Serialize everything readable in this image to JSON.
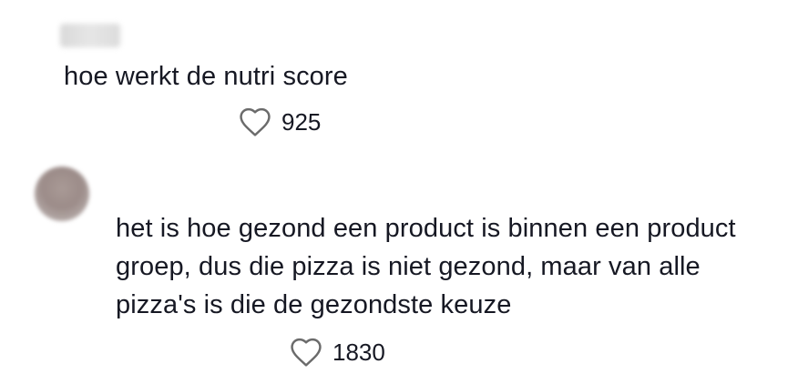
{
  "comments": [
    {
      "text": "hoe werkt de nutri score",
      "likes": "925",
      "like_icon": "heart-outline-icon"
    },
    {
      "text": "het is hoe gezond een product is binnen een product groep, dus die pizza is niet gezond, maar van alle pizza's is die de gezondste keuze",
      "likes": "1830",
      "like_icon": "heart-outline-icon"
    }
  ],
  "colors": {
    "text": "#161823",
    "icon": "#6b6b6b",
    "background": "#ffffff"
  }
}
